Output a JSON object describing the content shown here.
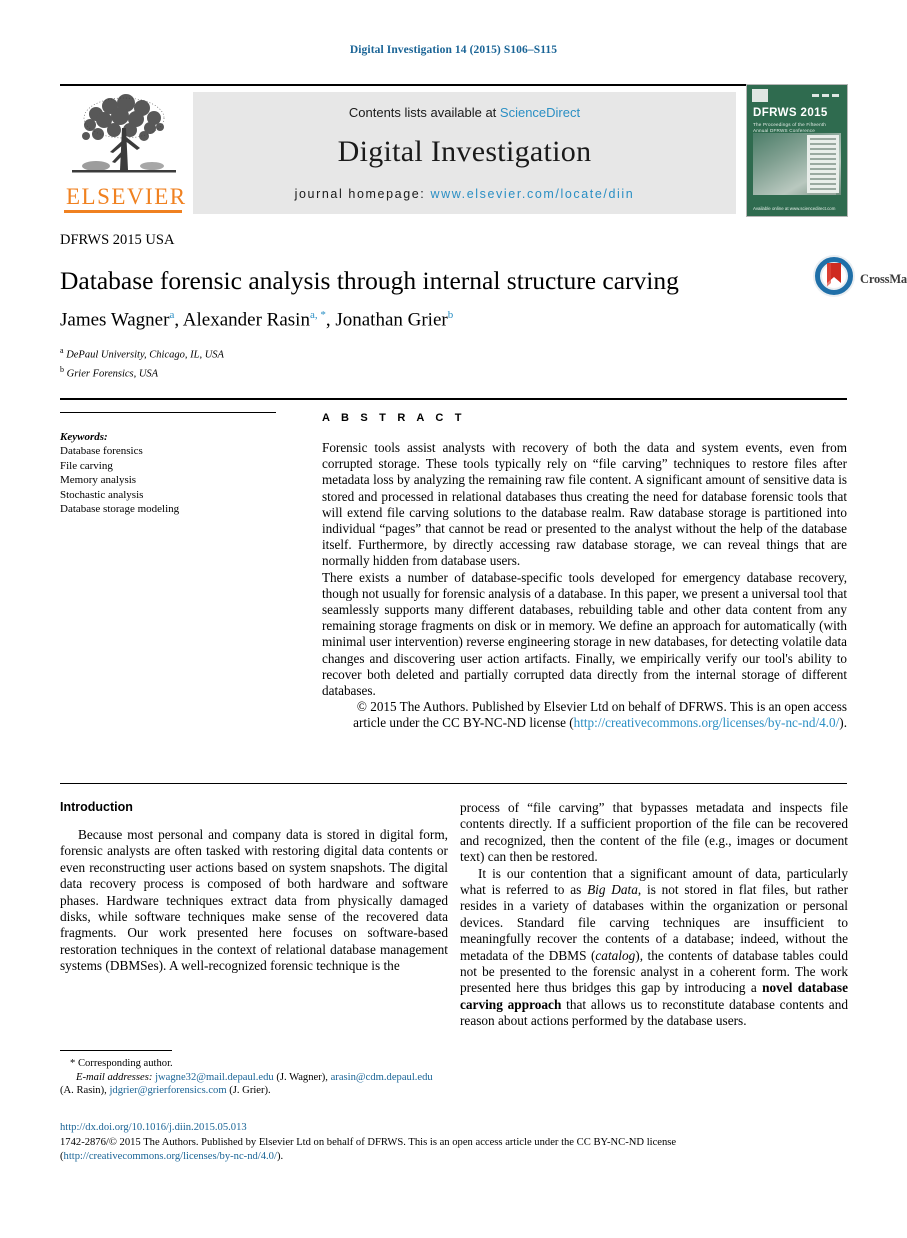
{
  "running_head": "Digital Investigation 14 (2015) S106–S115",
  "masthead": {
    "contents_prefix": "Contents lists available at ",
    "sciencedirect": "ScienceDirect",
    "journal_name": "Digital Investigation",
    "homepage_prefix": "journal homepage: ",
    "homepage_url": "www.elsevier.com/locate/diin",
    "publisher_word": "ELSEVIER",
    "publisher_logo_icon": "elsevier-tree-icon",
    "accent_link_color": "#2a8fc4",
    "publisher_color": "#f08120"
  },
  "cover": {
    "title": "DFRWS 2015",
    "subtitle": "The Proceedings of the Fifteenth Annual DFRWS Conference",
    "footer": "Available online at www.sciencedirect.com",
    "background_color": "#2f6b4f"
  },
  "article": {
    "section_label": "DFRWS 2015 USA",
    "title": "Database forensic analysis through internal structure carving",
    "authors": [
      {
        "name": "James Wagner",
        "marks": "a"
      },
      {
        "name": "Alexander Rasin",
        "marks": "a, *"
      },
      {
        "name": "Jonathan Grier",
        "marks": "b"
      }
    ],
    "affiliations": [
      {
        "mark": "a",
        "text": "DePaul University, Chicago, IL, USA"
      },
      {
        "mark": "b",
        "text": "Grier Forensics, USA"
      }
    ],
    "crossmark_label": "CrossMark",
    "crossmark_icon": "crossmark-icon"
  },
  "keywords": {
    "heading": "Keywords:",
    "items": [
      "Database forensics",
      "File carving",
      "Memory analysis",
      "Stochastic analysis",
      "Database storage modeling"
    ]
  },
  "abstract": {
    "heading": "A B S T R A C T",
    "paragraph1": "Forensic tools assist analysts with recovery of both the data and system events, even from corrupted storage. These tools typically rely on “file carving” techniques to restore files after metadata loss by analyzing the remaining raw file content. A significant amount of sensitive data is stored and processed in relational databases thus creating the need for database forensic tools that will extend file carving solutions to the database realm. Raw database storage is partitioned into individual “pages” that cannot be read or presented to the analyst without the help of the database itself. Furthermore, by directly accessing raw database storage, we can reveal things that are normally hidden from database users.",
    "paragraph2": "There exists a number of database-specific tools developed for emergency database recovery, though not usually for forensic analysis of a database. In this paper, we present a universal tool that seamlessly supports many different databases, rebuilding table and other data content from any remaining storage fragments on disk or in memory. We define an approach for automatically (with minimal user intervention) reverse engineering storage in new databases, for detecting volatile data changes and discovering user action artifacts. Finally, we empirically verify our tool's ability to recover both deleted and partially corrupted data directly from the internal storage of different databases.",
    "copyright_text": "© 2015  The Authors. Published by Elsevier Ltd on behalf of DFRWS. This is an open access article under the CC BY-NC-ND license (",
    "copyright_link": "http://creativecommons.org/licenses/by-nc-nd/4.0/",
    "copyright_suffix": ")."
  },
  "introduction": {
    "heading": "Introduction",
    "left_para1_a": "Because most personal and company data is stored in digital form, forensic analysts are often tasked with restoring digital data contents or even reconstructing user actions based on system snapshots. The digital data recovery process is composed of both hardware and software phases. Hardware techniques extract data from physically damaged disks, while software techniques make sense of the recovered data fragments. Our work presented here focuses on software-based restoration techniques in the context of relational database management systems (DBMSes). A well-recognized forensic technique is the",
    "right_para1_cont": "process of “file carving” that bypasses metadata and inspects file contents directly. If a sufficient proportion of the file can be recovered and recognized, then the content of the file (e.g., images or document text) can then be restored.",
    "right_para2_a": "It is our contention that a significant amount of data, particularly what is referred to as ",
    "right_para2_em1": "Big Data",
    "right_para2_b": ", is not stored in flat files, but rather resides in a variety of databases within the organization or personal devices. Standard file carving techniques are insufficient to meaningfully recover the contents of a database; indeed, without the metadata of the DBMS (",
    "right_para2_em2": "catalog",
    "right_para2_c": "), the contents of database tables could not be presented to the forensic analyst in a coherent form. The work presented here thus bridges this gap by introducing a ",
    "right_para2_strong": "novel database carving approach",
    "right_para2_d": " that allows us to reconstitute database contents and reason about actions performed by the database users."
  },
  "footnote": {
    "corresponding": "* Corresponding author.",
    "email_label": "E-mail addresses:",
    "emails": [
      {
        "address": "jwagne32@mail.depaul.edu",
        "person": "(J. Wagner),"
      },
      {
        "address": "arasin@cdm.depaul.edu",
        "person": "(A. Rasin),"
      },
      {
        "address": "jdgrier@grierforensics.com",
        "person": "(J. Grier)."
      }
    ]
  },
  "page_footer": {
    "doi": "http://dx.doi.org/10.1016/j.diin.2015.05.013",
    "issn_prefix": "1742-2876/© 2015  The Authors. Published by Elsevier Ltd on behalf of DFRWS. This is an open access article under the CC BY-NC-ND license (",
    "issn_link": "http://creativecommons.org/licenses/by-nc-nd/4.0/",
    "issn_suffix": ")."
  }
}
